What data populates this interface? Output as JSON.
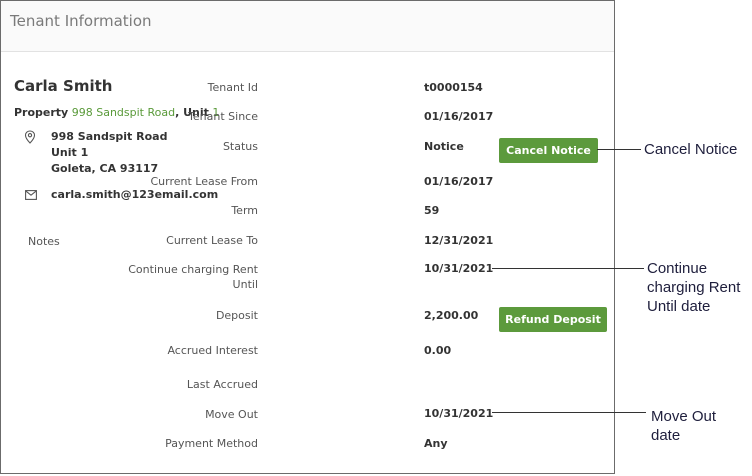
{
  "panel": {
    "title": "Tenant Information"
  },
  "tenant": {
    "name": "Carla Smith",
    "property_label": "Property",
    "property_link": "998 Sandspit Road",
    "unit_label": ", Unit",
    "unit_link": "1",
    "address": [
      "998 Sandspit Road",
      "Unit 1",
      "Goleta, CA 93117"
    ],
    "email": "carla.smith@123email.com",
    "notes_label": "Notes"
  },
  "details": {
    "tenant_id": {
      "label": "Tenant Id",
      "value": "t0000154"
    },
    "tenant_since": {
      "label": "Tenant Since",
      "value": "01/16/2017"
    },
    "status": {
      "label": "Status",
      "value": "Notice"
    },
    "lease_from": {
      "label": "Current Lease From",
      "value": "01/16/2017"
    },
    "term": {
      "label": "Term",
      "value": "59"
    },
    "lease_to": {
      "label": "Current Lease To",
      "value": "12/31/2021"
    },
    "charge_until": {
      "label_line1": "Continue charging Rent",
      "label_line2": "Until",
      "value": "10/31/2021"
    },
    "deposit": {
      "label": "Deposit",
      "value": "2,200.00"
    },
    "accrued_interest": {
      "label": "Accrued Interest",
      "value": "0.00"
    },
    "last_accrued": {
      "label": "Last Accrued",
      "value": ""
    },
    "move_out": {
      "label": "Move Out",
      "value": "10/31/2021"
    },
    "payment_method": {
      "label": "Payment Method",
      "value": "Any"
    }
  },
  "buttons": {
    "cancel_notice": "Cancel Notice",
    "refund_deposit": "Refund Deposit"
  },
  "callouts": {
    "cancel_notice": [
      "Cancel Notice"
    ],
    "charge_until": [
      "Continue",
      "charging Rent",
      "Until date"
    ],
    "move_out": [
      "Move Out",
      "date"
    ]
  },
  "icons": {
    "address": "map-pin-icon",
    "email": "envelope-icon"
  },
  "colors": {
    "accent_green": "#5c9a3c",
    "link_green": "#5a9a3a"
  }
}
